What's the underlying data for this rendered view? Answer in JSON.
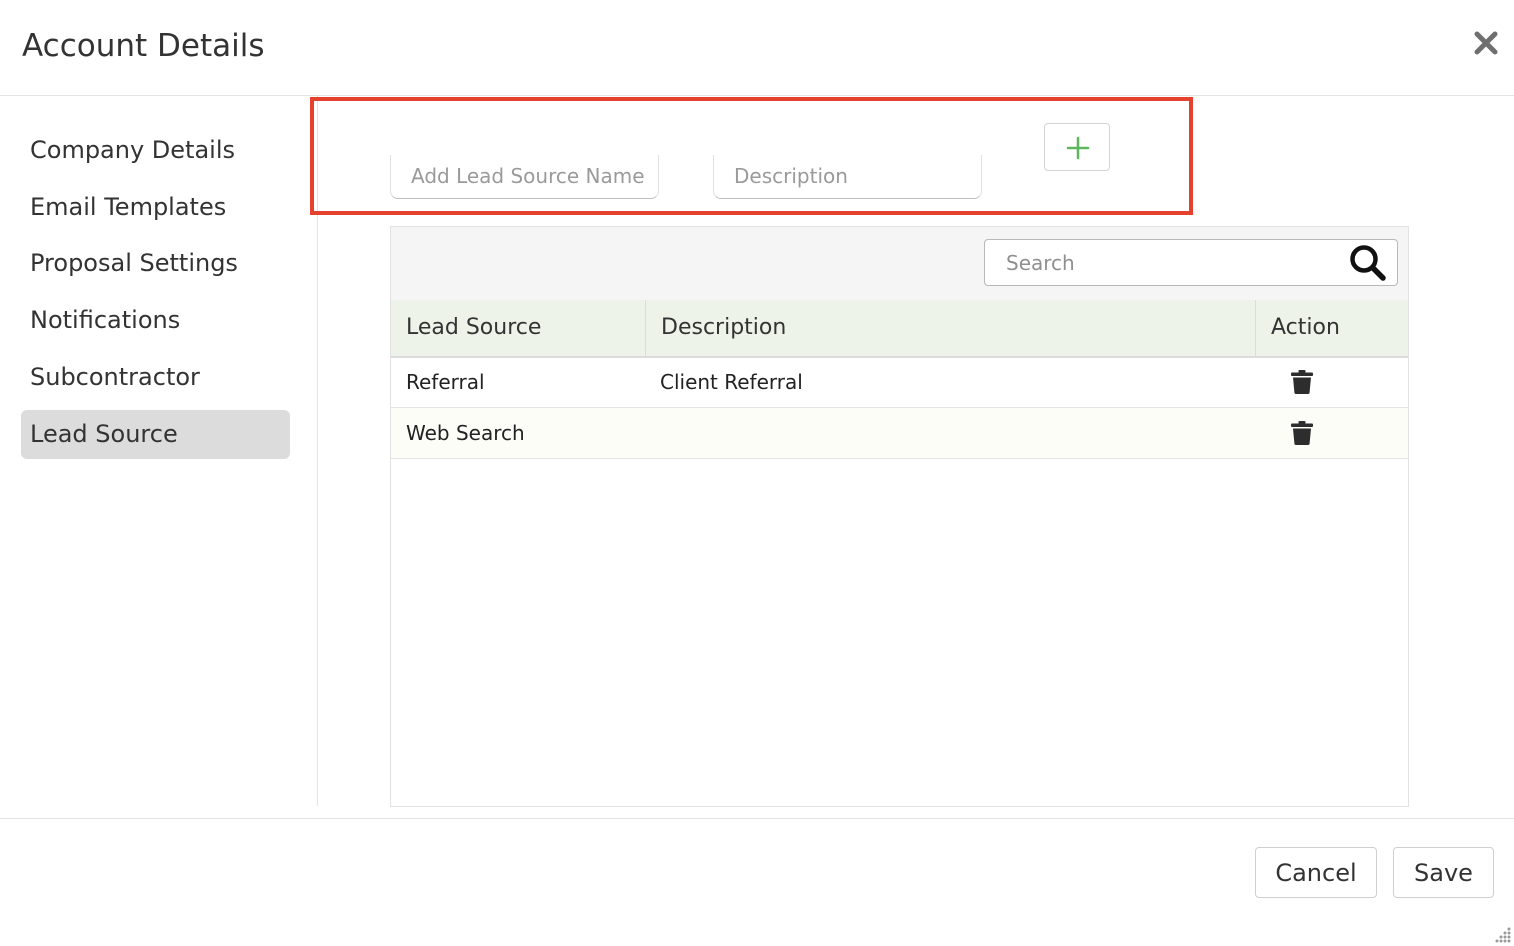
{
  "dialog": {
    "title": "Account Details",
    "close_icon": "close-icon"
  },
  "sidebar": {
    "items": [
      {
        "label": "Company Details"
      },
      {
        "label": "Email Templates"
      },
      {
        "label": "Proposal Settings"
      },
      {
        "label": "Notifications"
      },
      {
        "label": "Subcontractor"
      },
      {
        "label": "Lead Source",
        "active": true
      }
    ]
  },
  "form": {
    "name_placeholder": "Add Lead Source Name",
    "name_value": "",
    "description_placeholder": "Description",
    "description_value": "",
    "add_icon": "plus-icon"
  },
  "table": {
    "search_placeholder": "Search",
    "search_value": "",
    "columns": [
      "Lead Source",
      "Description",
      "Action"
    ],
    "rows": [
      {
        "lead_source": "Referral",
        "description": "Client Referral",
        "action_icon": "trash-icon"
      },
      {
        "lead_source": "Web Search",
        "description": "",
        "action_icon": "trash-icon"
      }
    ]
  },
  "footer": {
    "cancel_label": "Cancel",
    "save_label": "Save"
  },
  "colors": {
    "highlight": "#e5412e",
    "add_icon": "#5cb85c",
    "header_row": "#eef3e9",
    "active_nav": "#dcdcdc"
  }
}
